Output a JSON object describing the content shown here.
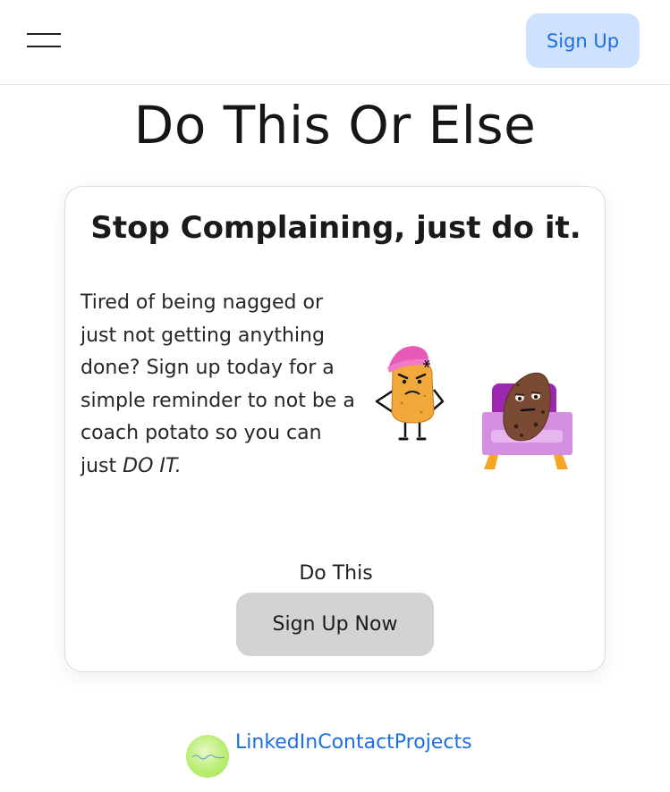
{
  "header": {
    "signup_label": "Sign Up"
  },
  "page": {
    "title": "Do This Or Else"
  },
  "card": {
    "title": "Stop Complaining, just do it.",
    "body_text": "Tired of being nagged or just not getting anything done? Sign up today for a simple reminder to not be a coach potato so you can just ",
    "body_emphasis": "DO IT.",
    "cta_caption": "Do This",
    "cta_label": "Sign Up Now"
  },
  "footer": {
    "links": [
      "LinkedIn",
      "Contact",
      "Projects"
    ]
  },
  "icons": {
    "menu": "hamburger-menu-icon",
    "logo": "site-logo"
  },
  "colors": {
    "accent": "#1d6fe0",
    "signup_bg": "#cfe2fd",
    "cta_bg": "#d3d3d6"
  }
}
